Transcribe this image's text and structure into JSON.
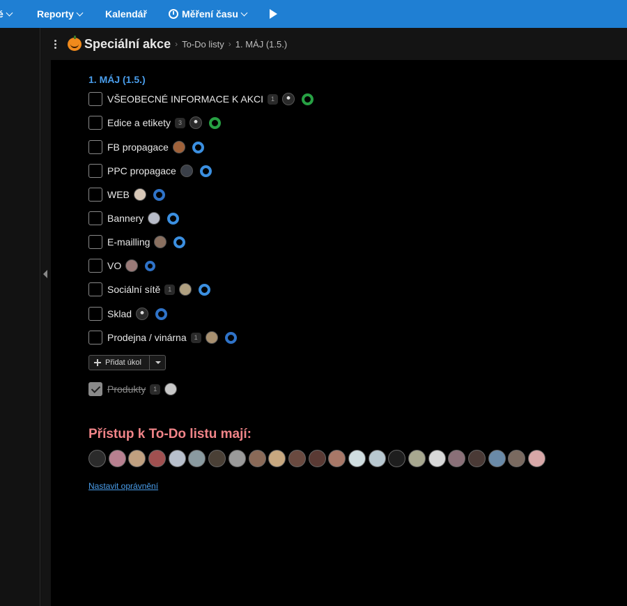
{
  "topbar": {
    "partial_item": "é",
    "reports_label": "Reporty",
    "calendar_label": "Kalendář",
    "time_label": "Měření času"
  },
  "breadcrumb": {
    "project": "Speciální akce",
    "section": "To-Do listy",
    "list": "1. MÁJ (1.5.)"
  },
  "list": {
    "title": "1. MÁJ (1.5.)",
    "tasks": [
      {
        "label": "VŠEOBECNÉ INFORMACE K AKCI",
        "count": "1",
        "progress": "complete"
      },
      {
        "label": "Edice a etikety",
        "count": "3",
        "progress": "complete"
      },
      {
        "label": "FB propagace",
        "count": "",
        "progress": "in-progress"
      },
      {
        "label": "PPC propagace",
        "count": "",
        "progress": "in-progress"
      },
      {
        "label": "WEB",
        "count": "",
        "progress": "in-progress"
      },
      {
        "label": "Bannery",
        "count": "",
        "progress": "in-progress"
      },
      {
        "label": "E-mailling",
        "count": "",
        "progress": "in-progress"
      },
      {
        "label": "VO",
        "count": "",
        "progress": "in-progress"
      },
      {
        "label": "Sociální sítě",
        "count": "1",
        "progress": "in-progress"
      },
      {
        "label": "Sklad",
        "count": "",
        "progress": "in-progress"
      },
      {
        "label": "Prodejna / vinárna",
        "count": "1",
        "progress": "in-progress"
      }
    ],
    "add_task_label": "Přidat úkol",
    "completed": [
      {
        "label": "Produkty",
        "count": "1",
        "checked": true
      }
    ]
  },
  "access": {
    "title": "Přístup k To-Do listu mají:",
    "people_count": 23,
    "permissions_link": "Nastavit oprávnění"
  },
  "colors": {
    "topbar": "#1f7fd3",
    "list_title": "#4a9eec",
    "access_title": "#f08488",
    "ring_complete": "#27a043",
    "ring_progress": "#3b8fe0"
  }
}
